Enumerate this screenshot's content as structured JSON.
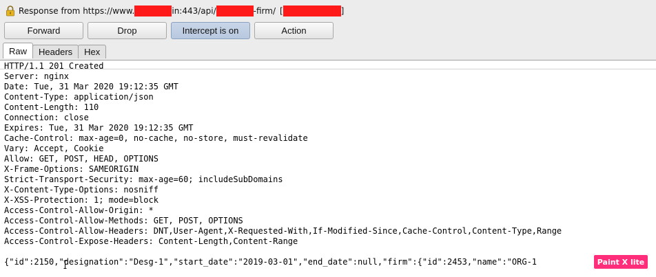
{
  "title": {
    "prefix": "Response from https://www.",
    "middle1": "in:443/api/",
    "middle2": "-firm/",
    "open_bracket": "[",
    "close_bracket": "]"
  },
  "toolbar": {
    "forward_label": "Forward",
    "drop_label": "Drop",
    "intercept_label": "Intercept is on",
    "action_label": "Action"
  },
  "tabs": [
    {
      "label": "Raw",
      "active": true
    },
    {
      "label": "Headers",
      "active": false
    },
    {
      "label": "Hex",
      "active": false
    }
  ],
  "response": {
    "headers": [
      "HTTP/1.1 201 Created",
      "Server: nginx",
      "Date: Tue, 31 Mar 2020 19:12:35 GMT",
      "Content-Type: application/json",
      "Content-Length: 110",
      "Connection: close",
      "Expires: Tue, 31 Mar 2020 19:12:35 GMT",
      "Cache-Control: max-age=0, no-cache, no-store, must-revalidate",
      "Vary: Accept, Cookie",
      "Allow: GET, POST, HEAD, OPTIONS",
      "X-Frame-Options: SAMEORIGIN",
      "Strict-Transport-Security: max-age=60; includeSubDomains",
      "X-Content-Type-Options: nosniff",
      "X-XSS-Protection: 1; mode=block",
      "Access-Control-Allow-Origin: *",
      "Access-Control-Allow-Methods: GET, POST, OPTIONS",
      "Access-Control-Allow-Headers: DNT,User-Agent,X-Requested-With,If-Modified-Since,Cache-Control,Content-Type,Range",
      "Access-Control-Expose-Headers: Content-Length,Content-Range"
    ],
    "body": "{\"id\":2150,\"designation\":\"Desg-1\",\"start_date\":\"2019-03-01\",\"end_date\":null,\"firm\":{\"id\":2453,\"name\":\"ORG-1"
  },
  "watermark": {
    "text": "Paint X lite",
    "color": "#ff2d7a"
  },
  "colors": {
    "redaction": "#ff1a1a",
    "pressed_button": "#c9d6e8"
  }
}
